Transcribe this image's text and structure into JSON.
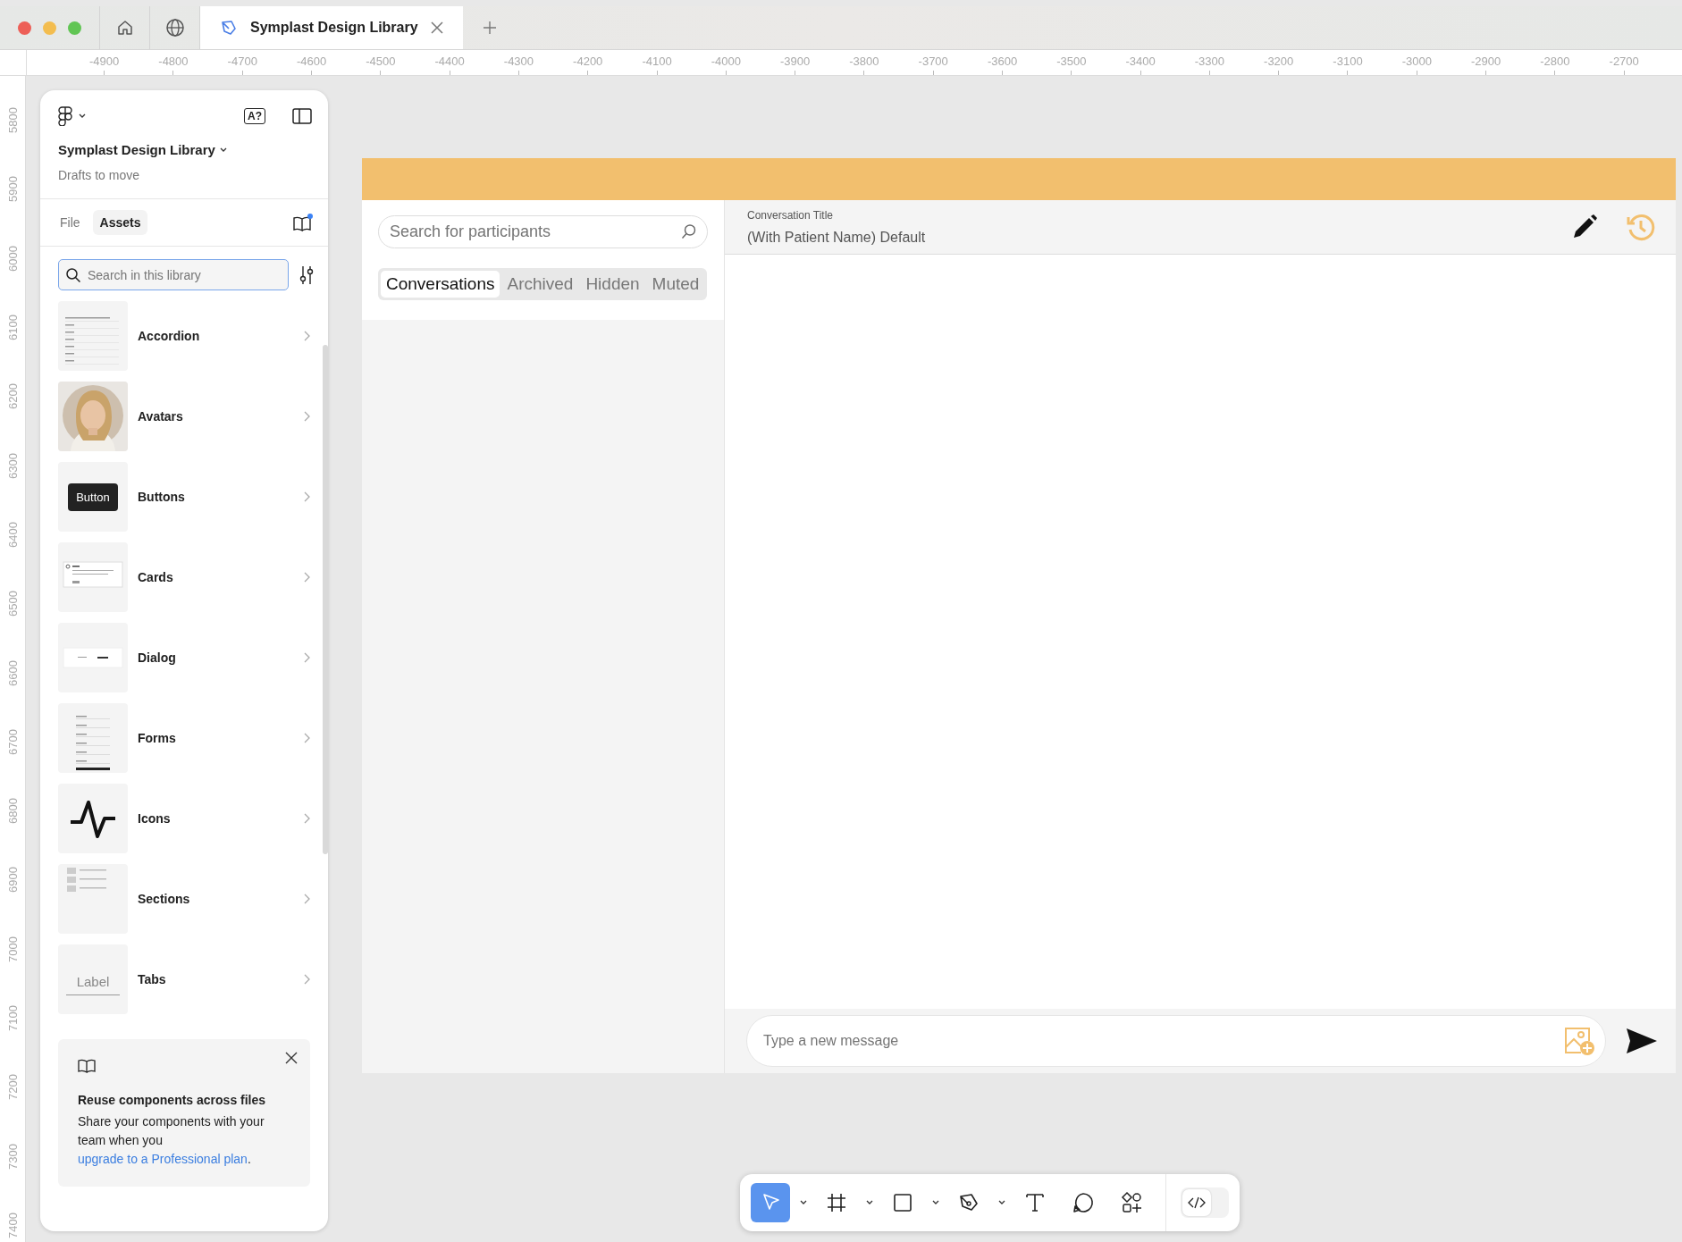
{
  "browser": {
    "tab": {
      "title": "Symplast Design Library"
    }
  },
  "rulers": {
    "horizontal": [
      "-4900",
      "-4800",
      "-4700",
      "-4600",
      "-4500",
      "-4400",
      "-4300",
      "-4200",
      "-4100",
      "-4000",
      "-3900",
      "-3800",
      "-3700",
      "-3600",
      "-3500",
      "-3400",
      "-3300",
      "-3200",
      "-3100",
      "-3000",
      "-2900",
      "-2800",
      "-2700"
    ],
    "vertical": [
      "5800",
      "5900",
      "6000",
      "6100",
      "6200",
      "6300",
      "6400",
      "6500",
      "6600",
      "6700",
      "6800",
      "6900",
      "7000",
      "7100",
      "7200",
      "7300",
      "7400"
    ]
  },
  "sidebar": {
    "file_title": "Symplast Design Library",
    "project": "Drafts to move",
    "badge": "A?",
    "tabs": [
      {
        "label": "File",
        "selected": false
      },
      {
        "label": "Assets",
        "selected": true
      }
    ],
    "search": {
      "placeholder": "Search in this library"
    },
    "libraries": [
      {
        "name": "Accordion",
        "kind": "accordion"
      },
      {
        "name": "Avatars",
        "kind": "avatar"
      },
      {
        "name": "Buttons",
        "kind": "button",
        "sample": "Button"
      },
      {
        "name": "Cards",
        "kind": "card"
      },
      {
        "name": "Dialog",
        "kind": "dialog"
      },
      {
        "name": "Forms",
        "kind": "form"
      },
      {
        "name": "Icons",
        "kind": "icon"
      },
      {
        "name": "Sections",
        "kind": "section"
      },
      {
        "name": "Tabs",
        "kind": "tabs",
        "sample": "Label"
      }
    ],
    "notice": {
      "title": "Reuse components across files",
      "text": "Share your components with your team when you ",
      "link": "upgrade to a Professional plan",
      "end": "."
    }
  },
  "design": {
    "search": {
      "placeholder": "Search for participants"
    },
    "tabs": [
      {
        "label": "Conversations",
        "selected": true
      },
      {
        "label": "Archived",
        "selected": false
      },
      {
        "label": "Hidden",
        "selected": false
      },
      {
        "label": "Muted",
        "selected": false
      }
    ],
    "title_label": "Conversation Title",
    "title_value": "(With Patient Name) Default",
    "message": {
      "placeholder": "Type a new message"
    }
  },
  "toolbar": {
    "tools": [
      {
        "kind": "move",
        "selected": true
      },
      {
        "kind": "frame",
        "selected": false
      },
      {
        "kind": "shape",
        "selected": false
      },
      {
        "kind": "pen",
        "selected": false
      },
      {
        "kind": "text",
        "selected": false
      },
      {
        "kind": "comment",
        "selected": false
      },
      {
        "kind": "actions",
        "selected": false
      }
    ],
    "dev_mode": {
      "on": false
    }
  }
}
